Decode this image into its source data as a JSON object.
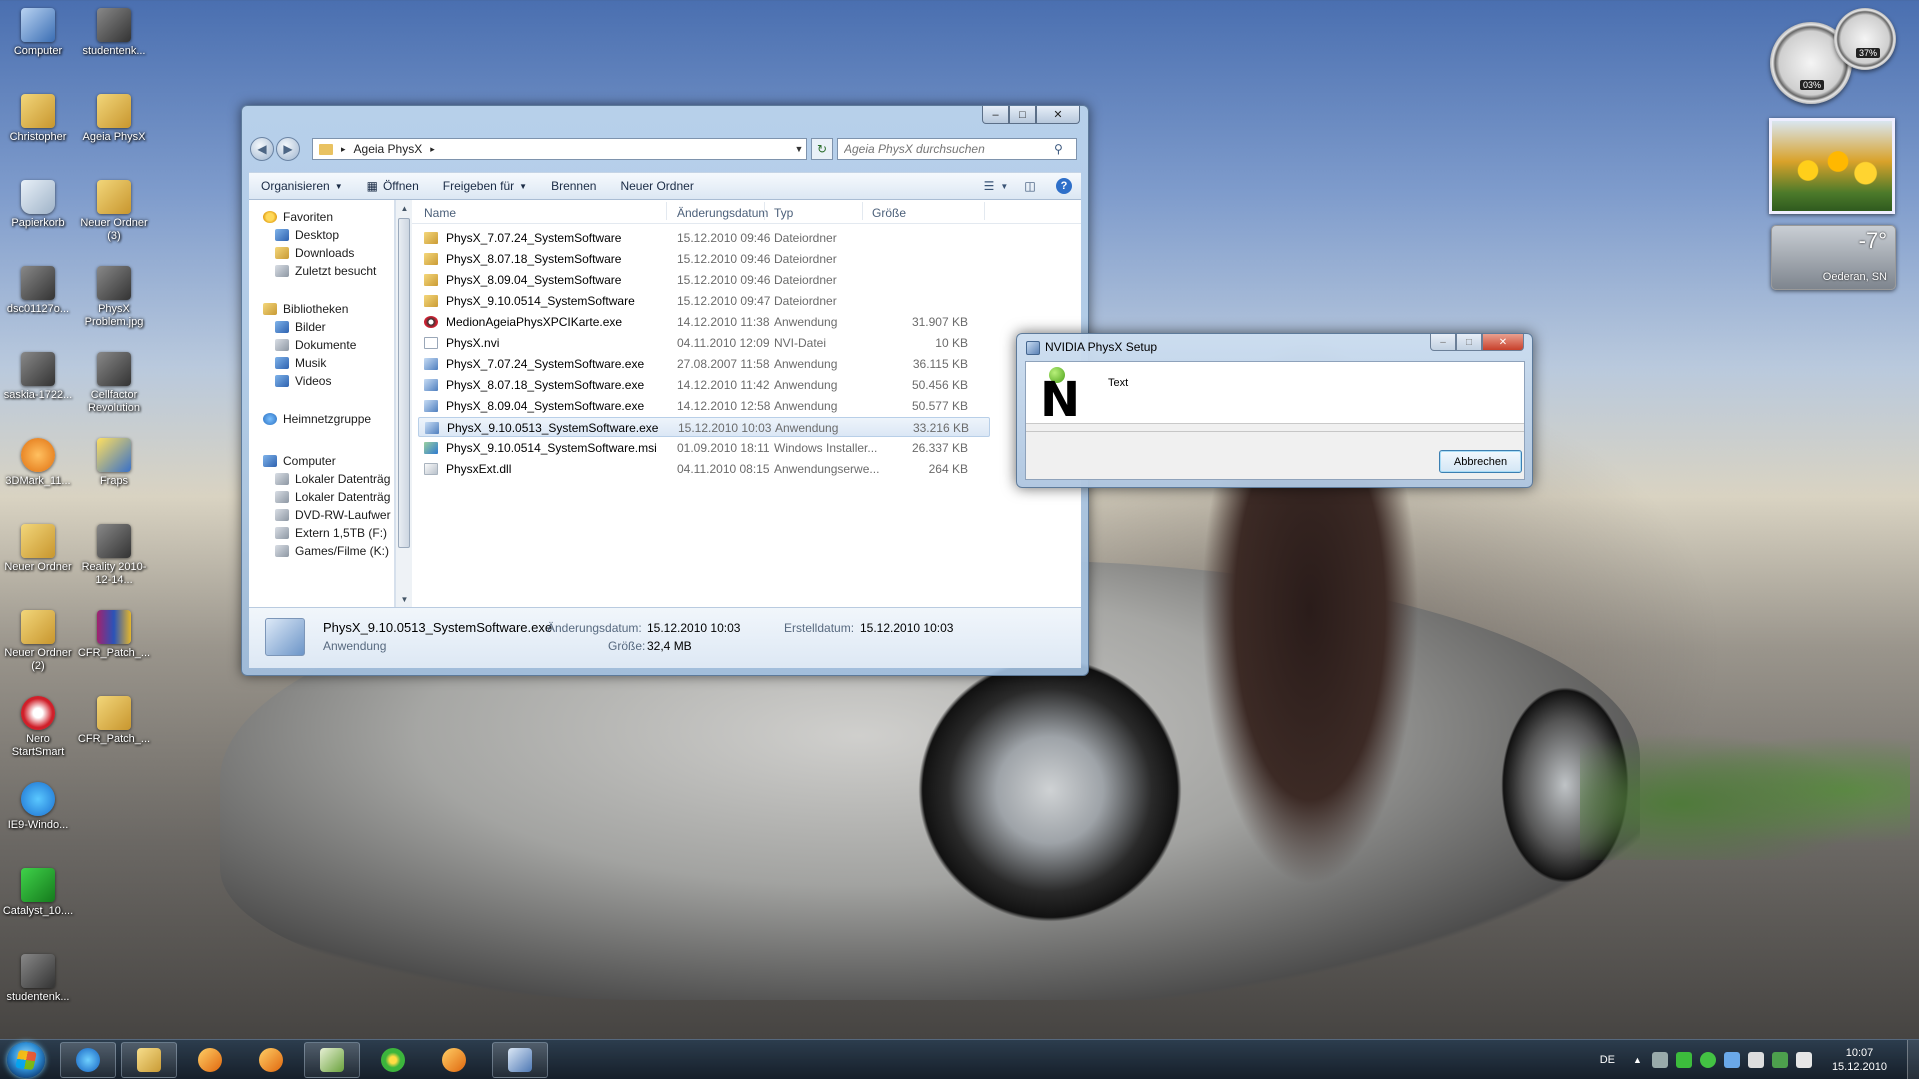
{
  "desktop": {
    "icons": [
      {
        "label": "Computer",
        "glyph": "computer-icon"
      },
      {
        "label": "studentenk...",
        "glyph": "image-icon"
      },
      {
        "label": "Christopher",
        "glyph": "folder-icon"
      },
      {
        "label": "Ageia PhysX",
        "glyph": "folder-icon"
      },
      {
        "label": "Papierkorb",
        "glyph": "recycle-bin-icon"
      },
      {
        "label": "Neuer Ordner (3)",
        "glyph": "folder-icon"
      },
      {
        "label": "dsc01127o...",
        "glyph": "image-icon"
      },
      {
        "label": "PhysX Problem.jpg",
        "glyph": "image-icon"
      },
      {
        "label": "saskia-1722...",
        "glyph": "image-icon"
      },
      {
        "label": "Cellfactor Revolution",
        "glyph": "game-icon"
      },
      {
        "label": "3DMark_11...",
        "glyph": "benchmark-icon"
      },
      {
        "label": "Fraps",
        "glyph": "fraps-icon"
      },
      {
        "label": "Neuer Ordner",
        "glyph": "folder-icon"
      },
      {
        "label": "Reality 2010-12-14...",
        "glyph": "image-icon"
      },
      {
        "label": "Neuer Ordner (2)",
        "glyph": "folder-icon"
      },
      {
        "label": "CFR_Patch_...",
        "glyph": "winrar-icon"
      },
      {
        "label": "Nero StartSmart",
        "glyph": "nero-icon"
      },
      {
        "label": "CFR_Patch_...",
        "glyph": "folder-icon"
      },
      {
        "label": "IE9-Windo...",
        "glyph": "internet-explorer-icon"
      },
      {
        "label": "Catalyst_10....",
        "glyph": "ati-catalyst-icon"
      },
      {
        "label": "studentenk...",
        "glyph": "image-icon"
      }
    ]
  },
  "gadgets": {
    "cpu_meter": {
      "cpu": "03%",
      "ram": "37%"
    },
    "weather": {
      "temperature": "-7°",
      "location": "Oederan, SN"
    }
  },
  "explorer": {
    "breadcrumb": [
      "Ageia PhysX"
    ],
    "search_placeholder": "Ageia PhysX durchsuchen",
    "toolbar": {
      "organize": "Organisieren",
      "open": "Öffnen",
      "share": "Freigeben für",
      "burn": "Brennen",
      "new_folder": "Neuer Ordner"
    },
    "nav": {
      "favorites_header": "Favoriten",
      "favorites": [
        "Desktop",
        "Downloads",
        "Zuletzt besucht"
      ],
      "libraries_header": "Bibliotheken",
      "libraries": [
        "Bilder",
        "Dokumente",
        "Musik",
        "Videos"
      ],
      "homegroup": "Heimnetzgruppe",
      "computer_header": "Computer",
      "drives": [
        "Lokaler Datenträg",
        "Lokaler Datenträg",
        "DVD-RW-Laufwer",
        "Extern 1,5TB (F:)",
        "Games/Filme (K:)"
      ]
    },
    "columns": {
      "name": "Name",
      "date": "Änderungsdatum",
      "type": "Typ",
      "size": "Größe"
    },
    "files": [
      {
        "name": "PhysX_7.07.24_SystemSoftware",
        "date": "15.12.2010 09:46",
        "type": "Dateiordner",
        "size": "",
        "kind": "dir"
      },
      {
        "name": "PhysX_8.07.18_SystemSoftware",
        "date": "15.12.2010 09:46",
        "type": "Dateiordner",
        "size": "",
        "kind": "dir"
      },
      {
        "name": "PhysX_8.09.04_SystemSoftware",
        "date": "15.12.2010 09:46",
        "type": "Dateiordner",
        "size": "",
        "kind": "dir"
      },
      {
        "name": "PhysX_9.10.0514_SystemSoftware",
        "date": "15.12.2010 09:47",
        "type": "Dateiordner",
        "size": "",
        "kind": "dir"
      },
      {
        "name": "MedionAgeiaPhysXPCIKarte.exe",
        "date": "14.12.2010 11:38",
        "type": "Anwendung",
        "size": "31.907 KB",
        "kind": "medion"
      },
      {
        "name": "PhysX.nvi",
        "date": "04.11.2010 12:09",
        "type": "NVI-Datei",
        "size": "10 KB",
        "kind": "nvi"
      },
      {
        "name": "PhysX_7.07.24_SystemSoftware.exe",
        "date": "27.08.2007 11:58",
        "type": "Anwendung",
        "size": "36.115 KB",
        "kind": "exe"
      },
      {
        "name": "PhysX_8.07.18_SystemSoftware.exe",
        "date": "14.12.2010 11:42",
        "type": "Anwendung",
        "size": "50.456 KB",
        "kind": "exe"
      },
      {
        "name": "PhysX_8.09.04_SystemSoftware.exe",
        "date": "14.12.2010 12:58",
        "type": "Anwendung",
        "size": "50.577 KB",
        "kind": "exe"
      },
      {
        "name": "PhysX_9.10.0513_SystemSoftware.exe",
        "date": "15.12.2010 10:03",
        "type": "Anwendung",
        "size": "33.216 KB",
        "kind": "exe",
        "selected": true
      },
      {
        "name": "PhysX_9.10.0514_SystemSoftware.msi",
        "date": "01.09.2010 18:11",
        "type": "Windows Installer...",
        "size": "26.337 KB",
        "kind": "msi"
      },
      {
        "name": "PhysxExt.dll",
        "date": "04.11.2010 08:15",
        "type": "Anwendungserwe...",
        "size": "264 KB",
        "kind": "dll"
      }
    ],
    "details": {
      "filename": "PhysX_9.10.0513_SystemSoftware.exe",
      "type": "Anwendung",
      "modified_label": "Änderungsdatum:",
      "modified_value": "15.12.2010 10:03",
      "size_label": "Größe:",
      "size_value": "32,4 MB",
      "created_label": "Erstelldatum:",
      "created_value": "15.12.2010 10:03"
    }
  },
  "dialog": {
    "title": "NVIDIA PhysX Setup",
    "body_text": "Text",
    "logo_letter": "N",
    "cancel_label": "Abbrechen"
  },
  "taskbar": {
    "language": "DE",
    "time": "10:07",
    "date": "15.12.2010"
  },
  "colors": {
    "selection": "#dbe7f5",
    "nvidia_green": "#76b900",
    "taskbar": "#1c2a3a"
  }
}
